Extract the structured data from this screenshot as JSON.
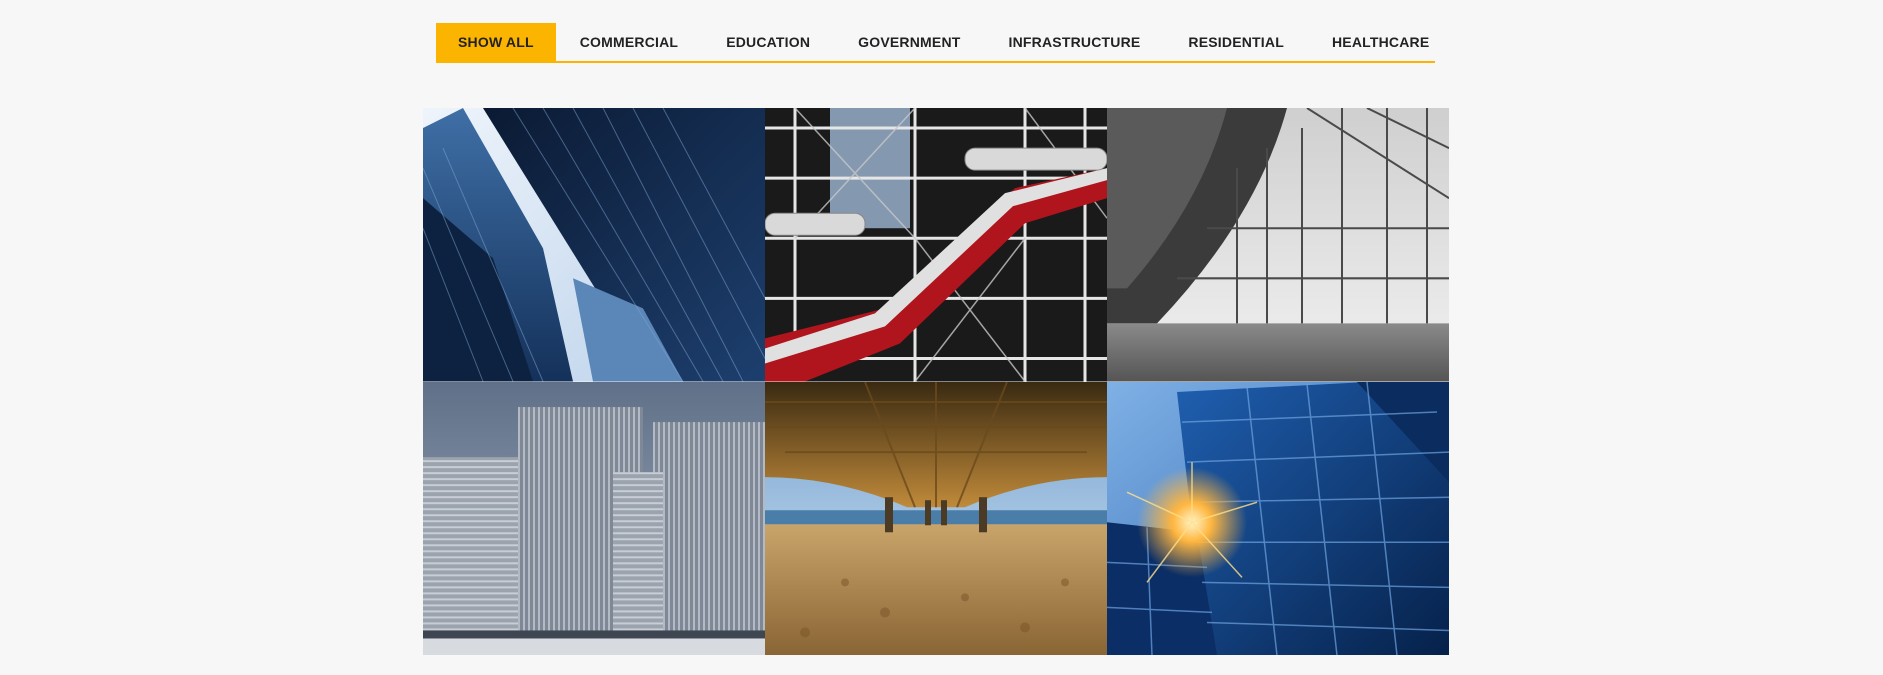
{
  "filters": {
    "items": [
      {
        "label": "SHOW ALL",
        "active": true
      },
      {
        "label": "COMMERCIAL",
        "active": false
      },
      {
        "label": "EDUCATION",
        "active": false
      },
      {
        "label": "GOVERNMENT",
        "active": false
      },
      {
        "label": "INFRASTRUCTURE",
        "active": false
      },
      {
        "label": "RESIDENTIAL",
        "active": false
      },
      {
        "label": "HEALTHCARE",
        "active": false
      }
    ],
    "accent_color": "#fbb400"
  },
  "gallery": {
    "tiles": [
      {
        "subject": "glass skyscrapers looking up",
        "palette": [
          "#0b1a33",
          "#2f5b8e",
          "#dfe9f5"
        ]
      },
      {
        "subject": "building facade with red escalator tubes",
        "palette": [
          "#1a1a1a",
          "#b0151e",
          "#d9d9d9"
        ]
      },
      {
        "subject": "glass atrium with curved roof, monochrome",
        "palette": [
          "#2a2a2a",
          "#9a9a9a",
          "#e8e8e8"
        ]
      },
      {
        "subject": "modern office towers",
        "palette": [
          "#6b7f9a",
          "#9aa6b4",
          "#c9ced6"
        ]
      },
      {
        "subject": "underside of pier over sandy beach",
        "palette": [
          "#3a2a12",
          "#c8a060",
          "#8fb8d8"
        ]
      },
      {
        "subject": "blue glass tower with sunburst",
        "palette": [
          "#06214a",
          "#1f5fb0",
          "#ffb640"
        ]
      }
    ]
  }
}
